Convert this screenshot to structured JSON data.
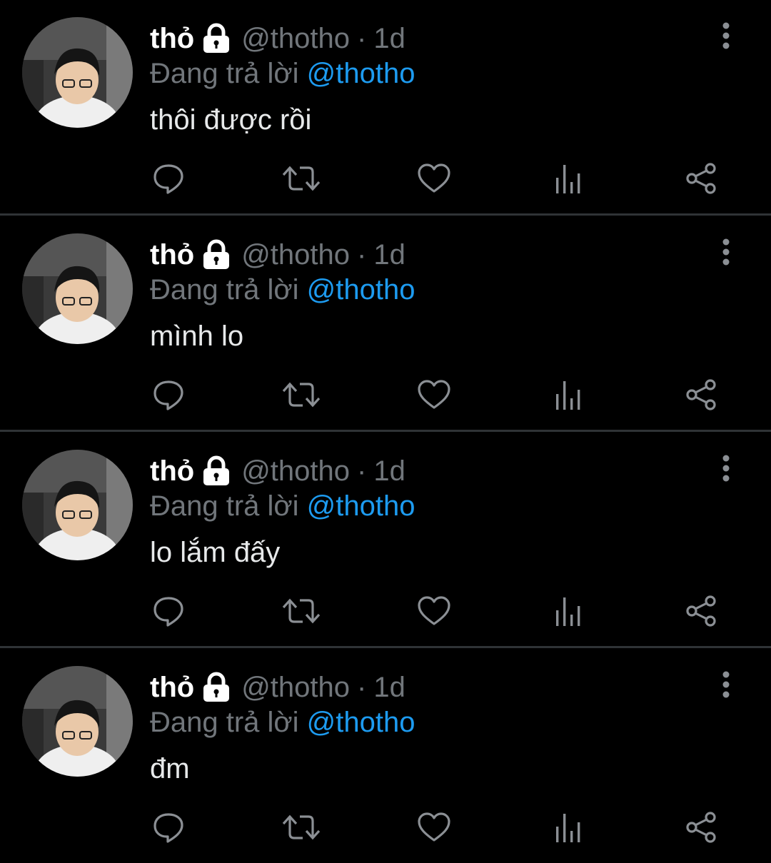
{
  "colors": {
    "background": "#000000",
    "primary_text": "#e7e9ea",
    "secondary_text": "#71767b",
    "link": "#1d9bf0",
    "divider": "#2f3336"
  },
  "tweets": [
    {
      "display_name": "thỏ",
      "handle": "@thotho",
      "separator": "·",
      "time": "1d",
      "reply_prefix": "Đang trả lời",
      "reply_to": "@thotho",
      "text": "thôi được rồi",
      "icons": [
        "lock-icon",
        "more-vertical-icon",
        "reply-icon",
        "retweet-icon",
        "heart-icon",
        "views-icon",
        "share-icon"
      ]
    },
    {
      "display_name": "thỏ",
      "handle": "@thotho",
      "separator": "·",
      "time": "1d",
      "reply_prefix": "Đang trả lời",
      "reply_to": "@thotho",
      "text": "mình lo",
      "icons": [
        "lock-icon",
        "more-vertical-icon",
        "reply-icon",
        "retweet-icon",
        "heart-icon",
        "views-icon",
        "share-icon"
      ]
    },
    {
      "display_name": "thỏ",
      "handle": "@thotho",
      "separator": "·",
      "time": "1d",
      "reply_prefix": "Đang trả lời",
      "reply_to": "@thotho",
      "text": "lo lắm đấy",
      "icons": [
        "lock-icon",
        "more-vertical-icon",
        "reply-icon",
        "retweet-icon",
        "heart-icon",
        "views-icon",
        "share-icon"
      ]
    },
    {
      "display_name": "thỏ",
      "handle": "@thotho",
      "separator": "·",
      "time": "1d",
      "reply_prefix": "Đang trả lời",
      "reply_to": "@thotho",
      "text": "đm",
      "icons": [
        "lock-icon",
        "more-vertical-icon",
        "reply-icon",
        "retweet-icon",
        "heart-icon",
        "views-icon",
        "share-icon"
      ]
    }
  ]
}
